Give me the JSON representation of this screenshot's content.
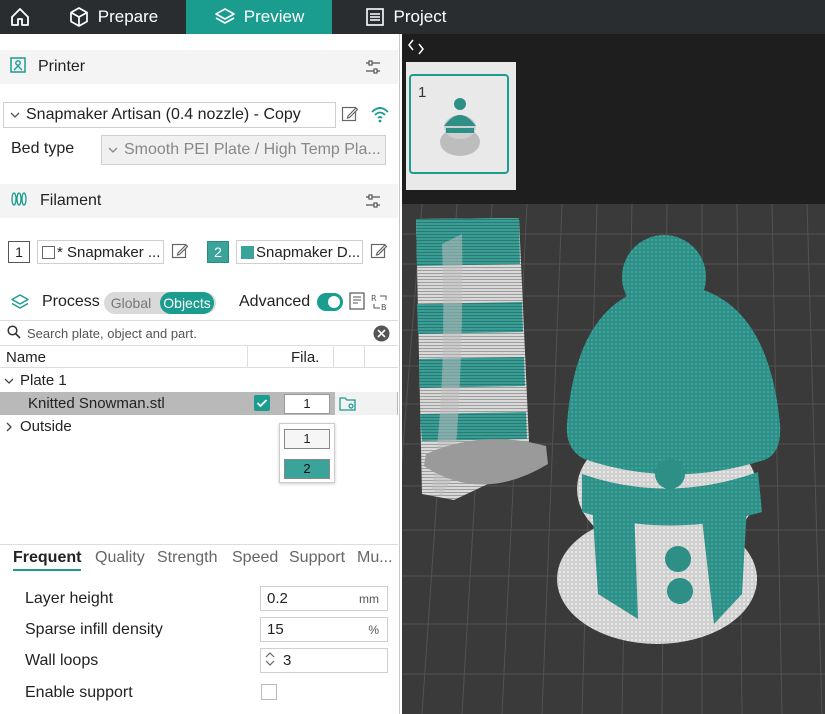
{
  "tabs": [
    {
      "label": ""
    },
    {
      "label": "Prepare"
    },
    {
      "label": "Preview"
    },
    {
      "label": "Project"
    }
  ],
  "printer": {
    "section_label": "Printer",
    "name": "Snapmaker Artisan (0.4 nozzle) - Copy",
    "bed_type_label": "Bed type",
    "bed_type_value": "Smooth PEI Plate / High Temp Pla..."
  },
  "filament": {
    "section_label": "Filament",
    "items": [
      {
        "index": "1",
        "name": "* Snapmaker ...",
        "color": "#ffffff"
      },
      {
        "index": "2",
        "name": "Snapmaker D...",
        "color": "#3aa39a"
      }
    ]
  },
  "process": {
    "label": "Process",
    "mode_global": "Global",
    "mode_objects": "Objects",
    "advanced_label": "Advanced",
    "advanced_on": true
  },
  "search": {
    "placeholder": "Search plate, object and part."
  },
  "object_tree": {
    "col_name": "Name",
    "col_fila": "Fila.",
    "plate": "Plate 1",
    "object": "Knitted Snowman.stl",
    "object_fila": "1",
    "outside": "Outside",
    "fila_options": [
      "1",
      "2"
    ]
  },
  "param_tabs": [
    "Frequent",
    "Quality",
    "Strength",
    "Speed",
    "Support",
    "Mu..."
  ],
  "settings": [
    {
      "label": "Layer height",
      "value": "0.2",
      "unit": "mm"
    },
    {
      "label": "Sparse infill density",
      "value": "15",
      "unit": "%"
    },
    {
      "label": "Wall loops",
      "value": "3",
      "unit": ""
    },
    {
      "label": "Enable support",
      "value": "",
      "unit": ""
    }
  ],
  "plate_thumb": {
    "number": "1"
  },
  "colors": {
    "accent": "#1a9c8e",
    "topbar": "#2a2d2f",
    "model_teal": "#2e8f87",
    "model_white": "#d8d8d8"
  }
}
